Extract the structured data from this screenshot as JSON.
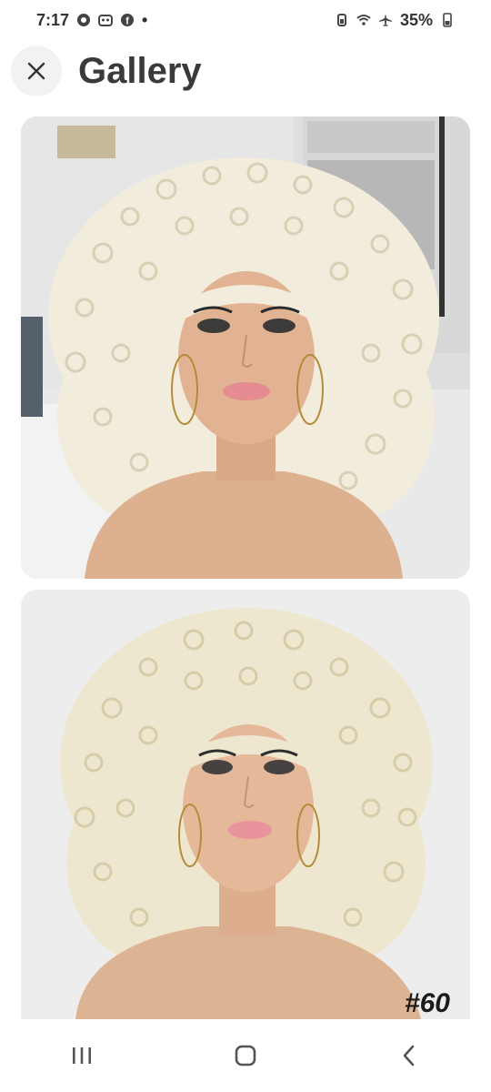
{
  "status_bar": {
    "time": "7:17",
    "battery": "35%",
    "left_icons": [
      "chrome-icon",
      "app-icon",
      "facebook-icon",
      "dot-icon"
    ],
    "right_icons": [
      "battery-saver-icon",
      "wifi-icon",
      "airplane-icon",
      "battery-icon"
    ]
  },
  "header": {
    "title": "Gallery",
    "close_icon": "close-icon"
  },
  "gallery": {
    "images": [
      {
        "subject": "blonde curly afro wig on mannequin with hoop earrings",
        "background": "indoor room"
      },
      {
        "subject": "blonde curly afro wig on mannequin with hoop earrings",
        "background": "plain light gray",
        "label": "#60"
      }
    ]
  },
  "nav_bar": {
    "items": [
      "recent-apps-icon",
      "home-icon",
      "back-icon"
    ]
  }
}
